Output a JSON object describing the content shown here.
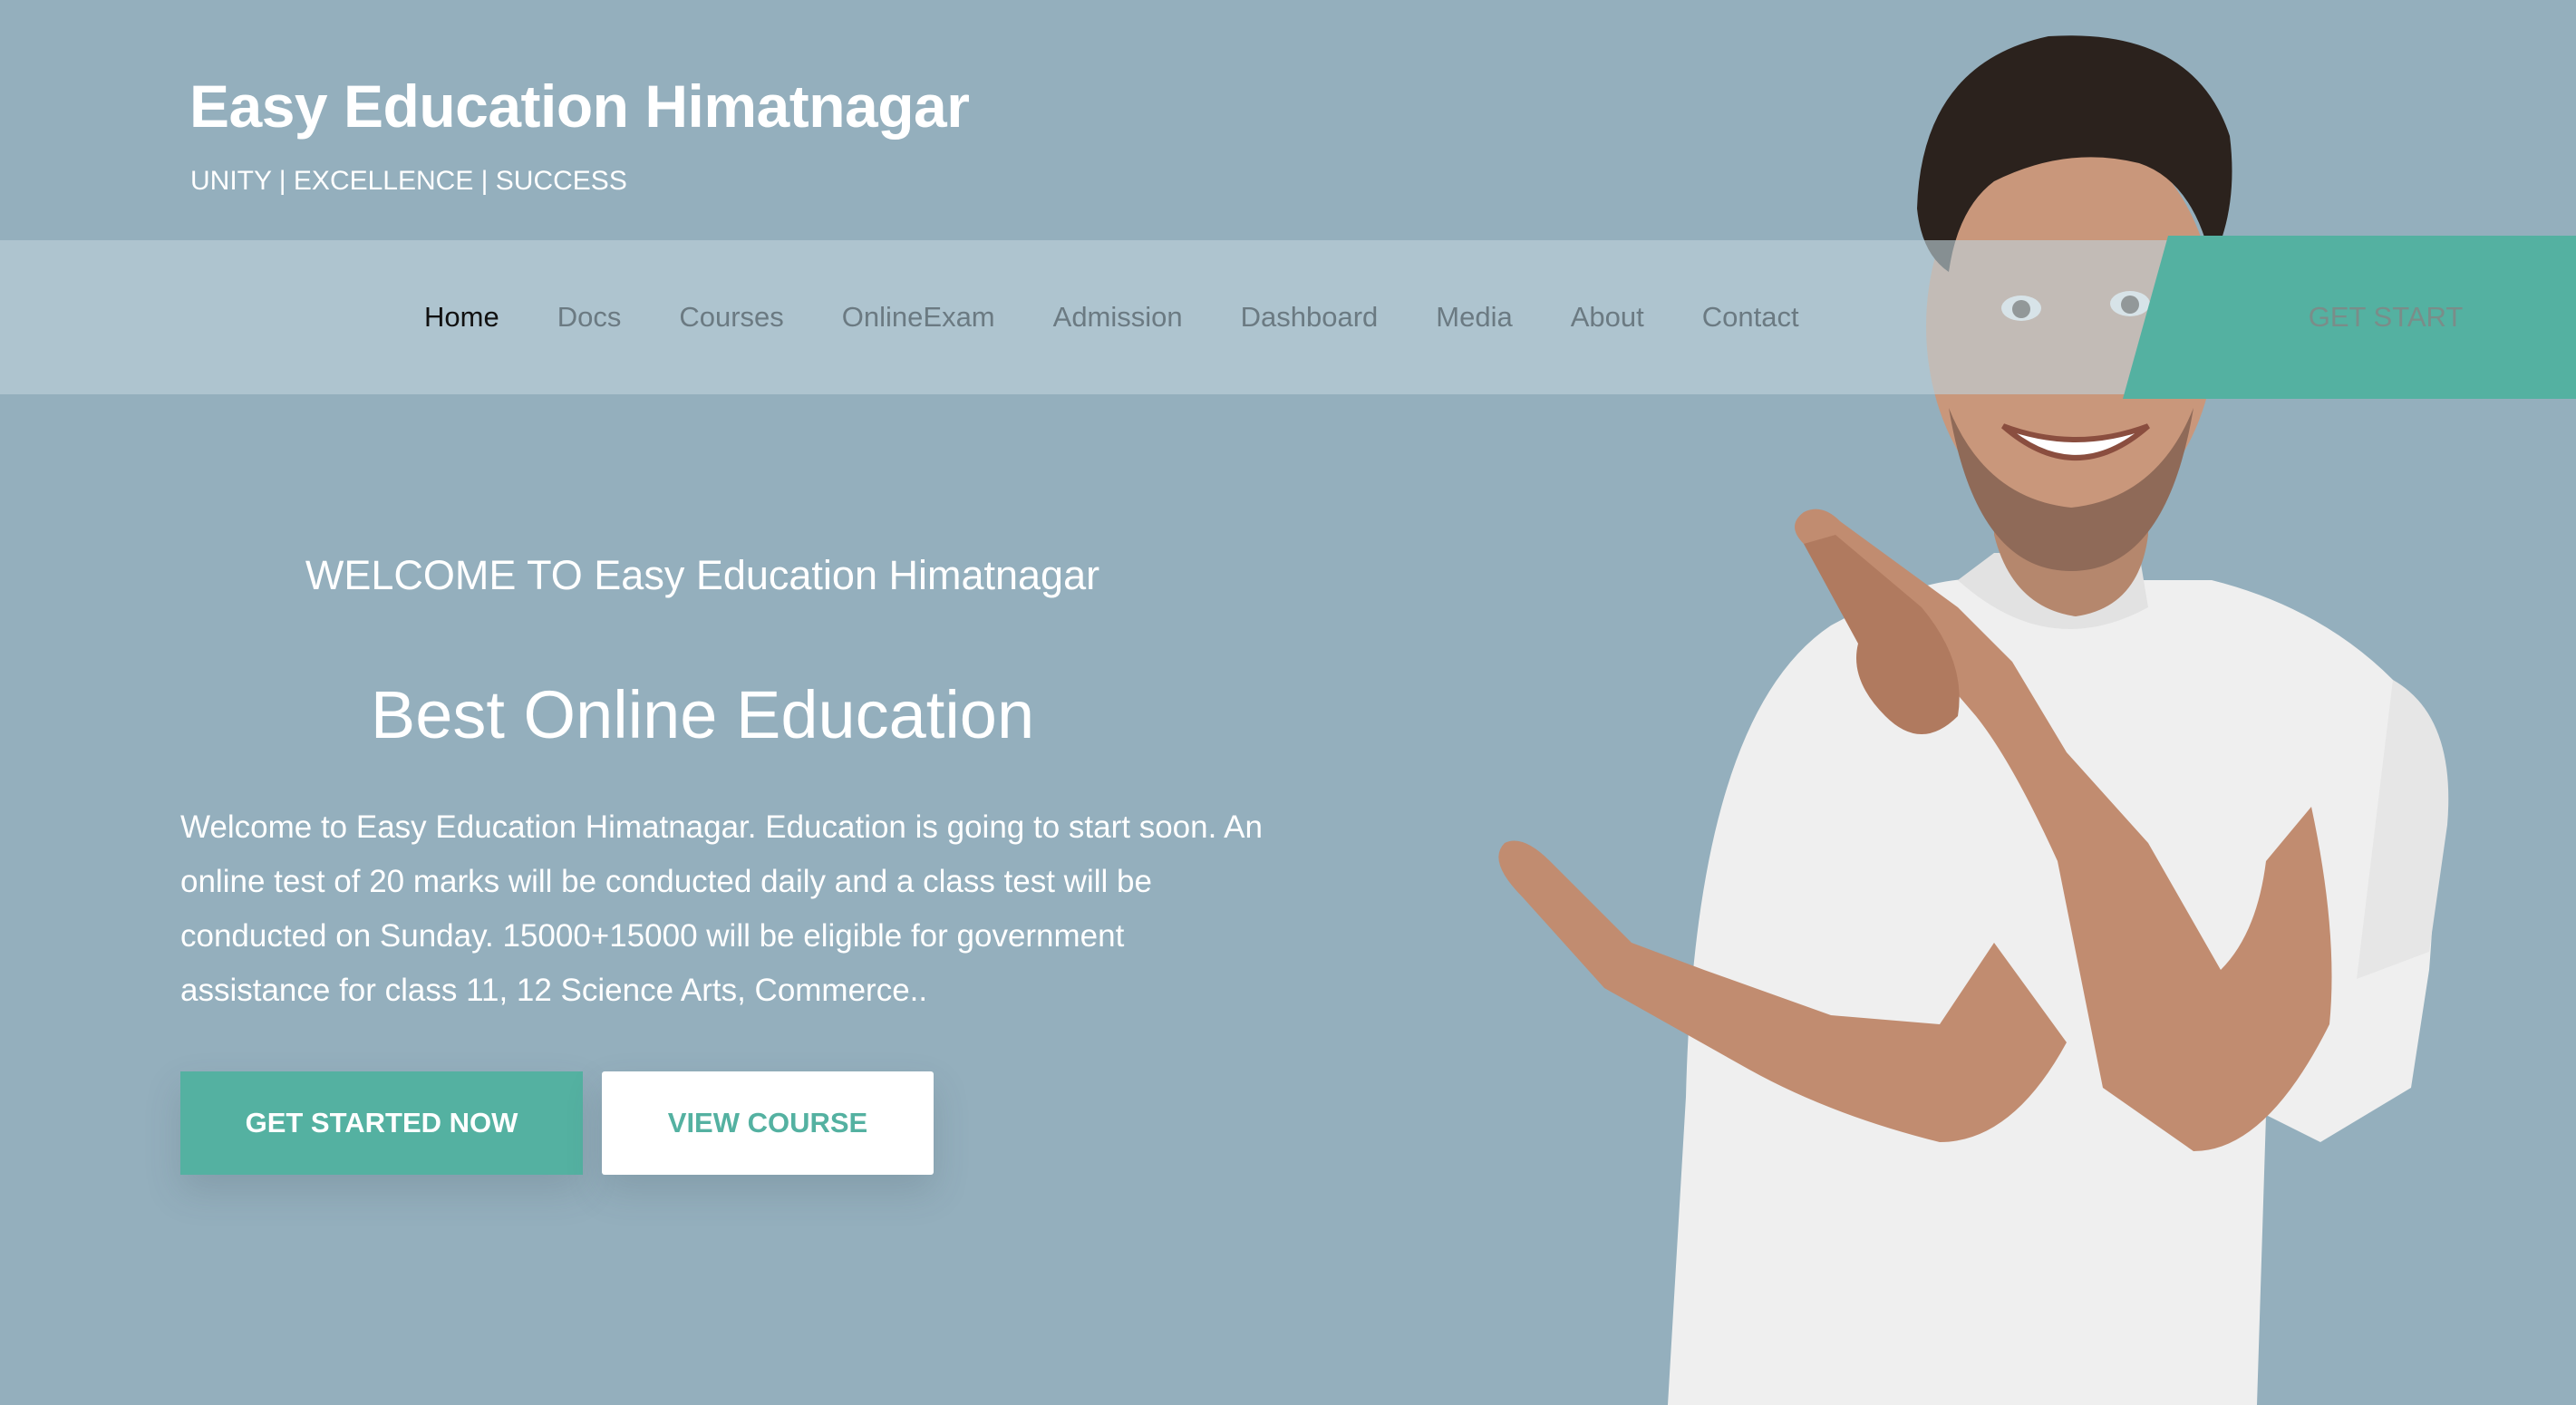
{
  "brand": {
    "title": "Easy Education Himatnagar",
    "tagline": "UNITY | EXCELLENCE | SUCCESS"
  },
  "nav": {
    "items": [
      {
        "label": "Home",
        "active": true
      },
      {
        "label": "Docs",
        "active": false
      },
      {
        "label": "Courses",
        "active": false
      },
      {
        "label": "OnlineExam",
        "active": false
      },
      {
        "label": "Admission",
        "active": false
      },
      {
        "label": "Dashboard",
        "active": false
      },
      {
        "label": "Media",
        "active": false
      },
      {
        "label": "About",
        "active": false
      },
      {
        "label": "Contact",
        "active": false
      }
    ],
    "cta_label": "GET START"
  },
  "hero": {
    "welcome": "WELCOME TO Easy Education Himatnagar",
    "headline": "Best Online Education",
    "description": "Welcome to Easy Education Himatnagar. Education is going to start soon. An online test of 20 marks will be conducted daily and a class test will be conducted on Sunday. 15000+15000 will be eligible for government assistance for class 11, 12 Science Arts, Commerce..",
    "primary_button": "GET STARTED NOW",
    "secondary_button": "VIEW COURSE",
    "image_icon": "smiling-man-pointing-photo"
  },
  "colors": {
    "background": "#94afbd",
    "accent": "#54b1a1",
    "nav_text": "#6b7a82",
    "nav_active": "#111111"
  }
}
